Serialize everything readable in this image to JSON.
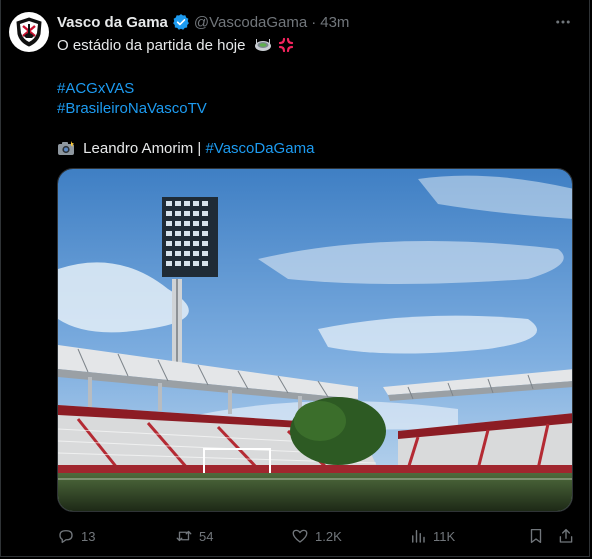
{
  "tweet": {
    "author_name": "Vasco da Gama",
    "handle": "@VascodaGama",
    "separator": "·",
    "time": "43m",
    "text_line1": "O estádio da partida de hoje",
    "hashtag1": "#ACGxVAS",
    "hashtag2": "#BrasileiroNaVascoTV",
    "credit_prefix": "Leandro Amorim |",
    "credit_hashtag": "#VascoDaGama"
  },
  "actions": {
    "replies": "13",
    "reposts": "54",
    "likes": "1.2K",
    "views": "11K"
  },
  "colors": {
    "background": "#000000",
    "text": "#e7e9ea",
    "secondary": "#71767b",
    "link": "#1d9bf0",
    "verified": "#1d9bf0"
  },
  "icons": [
    "vasco-crest-icon",
    "verified-badge-icon",
    "more-icon",
    "stadium-emoji-icon",
    "anger-emoji-icon",
    "camera-emoji-icon",
    "reply-icon",
    "repost-icon",
    "like-icon",
    "views-icon",
    "bookmark-icon",
    "share-icon"
  ]
}
